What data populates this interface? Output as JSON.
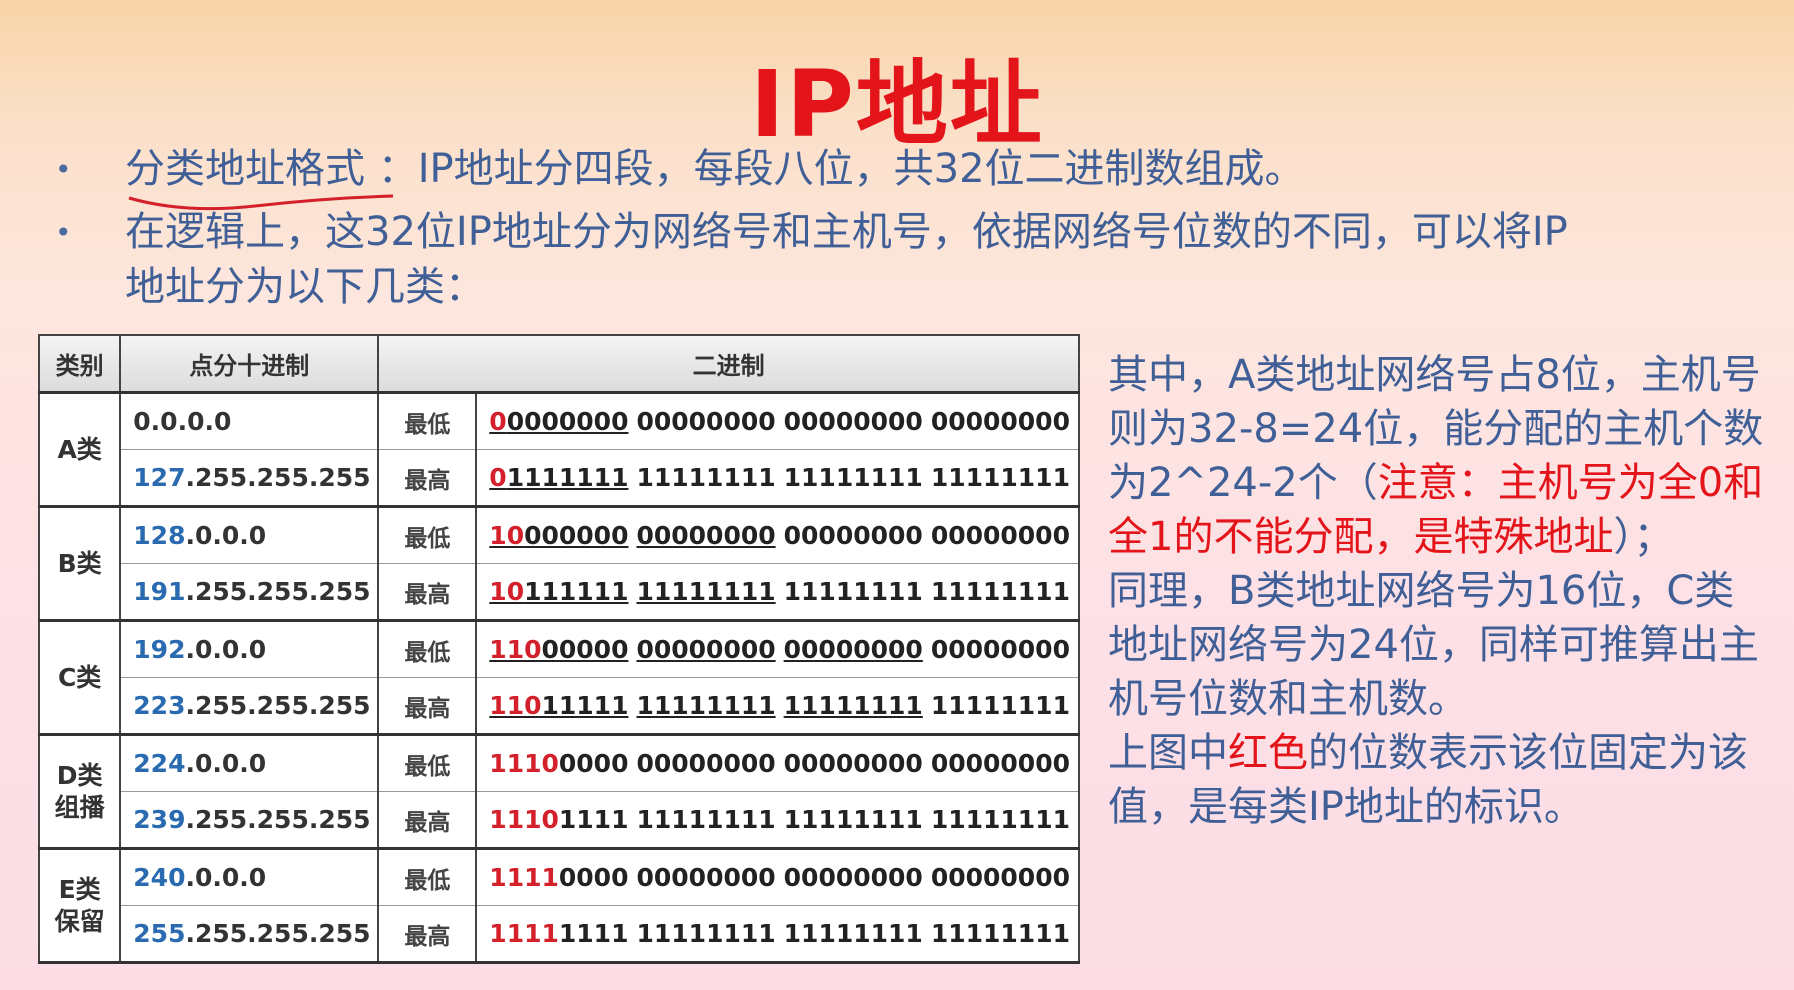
{
  "title": "IP地址",
  "bullets": {
    "b1_term": "分类地址格式",
    "b1_rest": "：IP地址分四段，每段八位，共32位二进制数组成。",
    "b2_line1": "在逻辑上，这32位IP地址分为网络号和主机号，依据网络号位数的不同，可以将IP",
    "b2_line2": "地址分为以下几类："
  },
  "table": {
    "headers": [
      "类别",
      "点分十进制",
      "二进制"
    ],
    "classes": [
      {
        "label": "A类",
        "rows": [
          {
            "dec_hl": "",
            "dec": "0.0.0.0",
            "lh": "最低",
            "bin": "00000000 00000000 00000000 00000000",
            "red_bits": 1,
            "underline_bits": 8
          },
          {
            "dec_hl": "127",
            "dec": ".255.255.255",
            "lh": "最高",
            "bin": "01111111 11111111 11111111 11111111",
            "red_bits": 1,
            "underline_bits": 8
          }
        ]
      },
      {
        "label": "B类",
        "rows": [
          {
            "dec_hl": "128",
            "dec": ".0.0.0",
            "lh": "最低",
            "bin": "10000000 00000000 00000000 00000000",
            "red_bits": 2,
            "underline_bits": 16
          },
          {
            "dec_hl": "191",
            "dec": ".255.255.255",
            "lh": "最高",
            "bin": "10111111 11111111 11111111 11111111",
            "red_bits": 2,
            "underline_bits": 16
          }
        ]
      },
      {
        "label": "C类",
        "rows": [
          {
            "dec_hl": "192",
            "dec": ".0.0.0",
            "lh": "最低",
            "bin": "11000000 00000000 00000000 00000000",
            "red_bits": 3,
            "underline_bits": 24
          },
          {
            "dec_hl": "223",
            "dec": ".255.255.255",
            "lh": "最高",
            "bin": "11011111 11111111 11111111 11111111",
            "red_bits": 3,
            "underline_bits": 24
          }
        ]
      },
      {
        "label": "D类\n组播",
        "rows": [
          {
            "dec_hl": "224",
            "dec": ".0.0.0",
            "lh": "最低",
            "bin": "11100000 00000000 00000000 00000000",
            "red_bits": 4,
            "underline_bits": 0
          },
          {
            "dec_hl": "239",
            "dec": ".255.255.255",
            "lh": "最高",
            "bin": "11101111 11111111 11111111 11111111",
            "red_bits": 4,
            "underline_bits": 0
          }
        ]
      },
      {
        "label": "E类\n保留",
        "rows": [
          {
            "dec_hl": "240",
            "dec": ".0.0.0",
            "lh": "最低",
            "bin": "11110000 00000000 00000000 00000000",
            "red_bits": 4,
            "underline_bits": 0
          },
          {
            "dec_hl": "255",
            "dec": ".255.255.255",
            "lh": "最高",
            "bin": "11111111 11111111 11111111 11111111",
            "red_bits": 4,
            "underline_bits": 0
          }
        ]
      }
    ]
  },
  "side": {
    "p1_blue": "其中，A类地址网络号占8位，主机号则为32-8=24位，能分配的主机个数为2^24-2个（",
    "p1_red": "注意：主机号为全0和全1的不能分配，是特殊地址",
    "p1_end": "）；",
    "p2_blue": "同理，B类地址网络号为16位，C类地址网络号为24位，同样可推算出主机号位数和主机数。",
    "p3_a": "上图中",
    "p3_red": "红色",
    "p3_b": "的位数表示该位固定为该值，是每类IP地址的标识。"
  },
  "colors": {
    "accent_red": "#e4141b",
    "text_blue": "#3f5f96",
    "dec_blue": "#2a6ab0"
  }
}
